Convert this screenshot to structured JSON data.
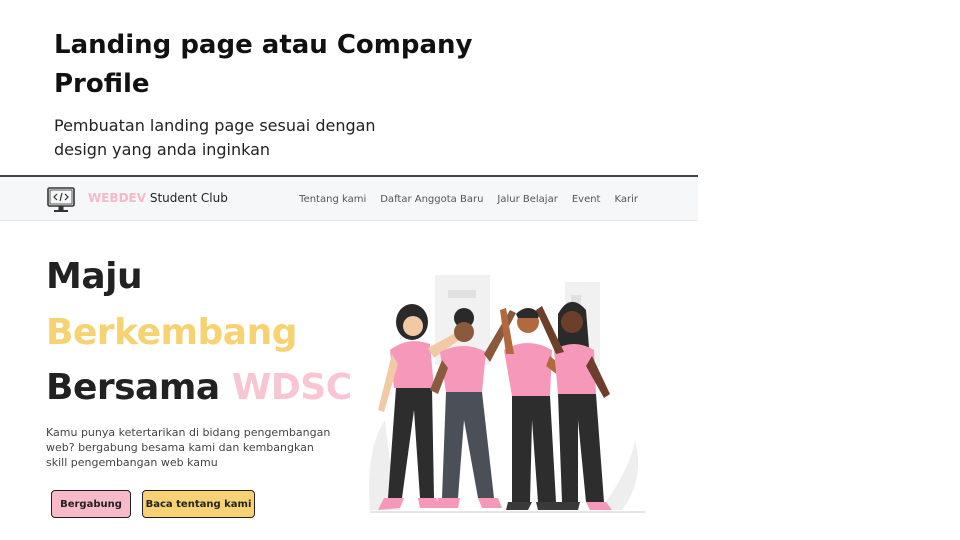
{
  "slide": {
    "title": "Landing page atau Company Profile",
    "subtitle": "Pembuatan landing page  sesuai dengan design yang anda inginkan"
  },
  "mockup": {
    "navbar": {
      "brand_accent": "WEBDEV",
      "brand_rest": "Student Club",
      "links": [
        "Tentang kami",
        "Daftar Anggota Baru",
        "Jalur Belajar",
        "Event",
        "Karir"
      ]
    },
    "hero": {
      "line1": "Maju",
      "line2": "Berkembang",
      "line3_prefix": "Bersama",
      "line3_accent": "WDSC",
      "description": "Kamu punya ketertarikan di bidang pengembangan web? bergabung besama kami dan kembangkan skill pengembangan web kamu",
      "primary_button": "Bergabung",
      "secondary_button": "Baca tentang kami"
    },
    "illustration_icon": "people-high-five-illustration"
  },
  "colors": {
    "pink": "#f8b9c9",
    "yellow": "#f6d272",
    "dark": "#222222",
    "navbar_bg": "#f6f7f8"
  }
}
